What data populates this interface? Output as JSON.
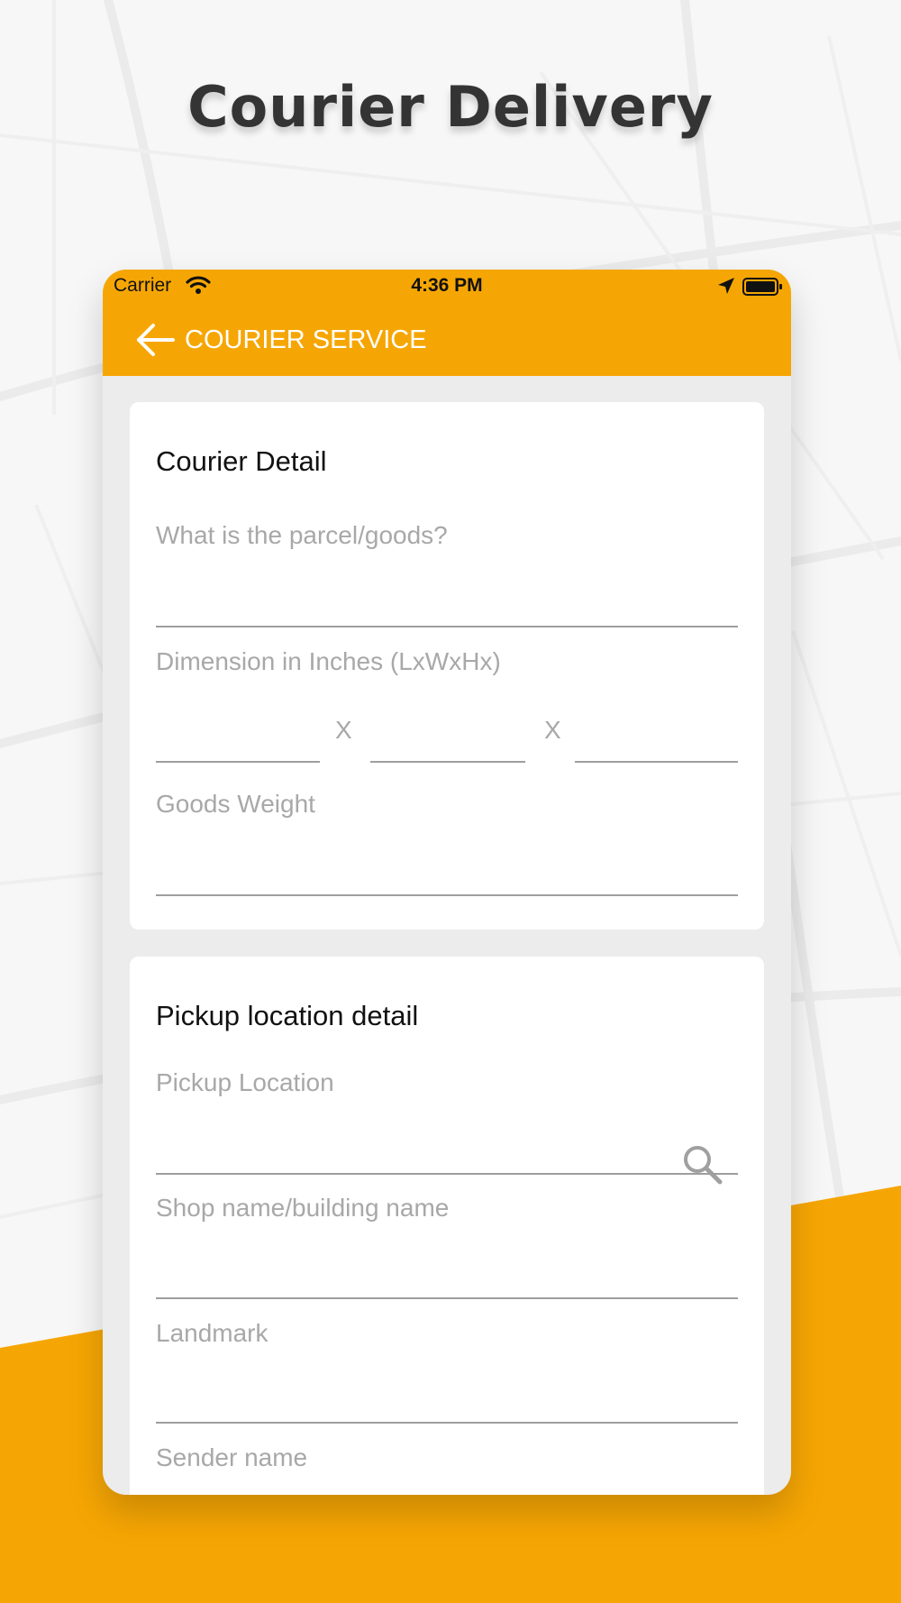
{
  "promo": {
    "title": "Courier Delivery"
  },
  "colors": {
    "accent": "#F6A604",
    "background": "#F4F4F4",
    "card": "#FFFFFF",
    "label": "#A8A8A8",
    "underline": "#9E9E9E",
    "heading": "#111111"
  },
  "status_bar": {
    "carrier": "Carrier",
    "time": "4:36 PM",
    "icons": [
      "wifi-icon",
      "location-arrow-icon",
      "battery-icon"
    ]
  },
  "nav": {
    "back_icon": "arrow-left-icon",
    "title": "COURIER SERVICE"
  },
  "courier_detail": {
    "heading": "Courier Detail",
    "goods_label": "What is the parcel/goods?",
    "goods_value": "",
    "dimension_label": "Dimension in Inches (LxWxHx)",
    "dimension_separator": "X",
    "length_value": "",
    "width_value": "",
    "height_value": "",
    "weight_label": "Goods Weight",
    "weight_value": ""
  },
  "pickup_detail": {
    "heading": "Pickup location detail",
    "location_label": "Pickup Location",
    "location_value": "",
    "search_icon": "search-icon",
    "shop_label": "Shop name/building name",
    "shop_value": "",
    "landmark_label": "Landmark",
    "landmark_value": "",
    "sender_label": "Sender name"
  }
}
